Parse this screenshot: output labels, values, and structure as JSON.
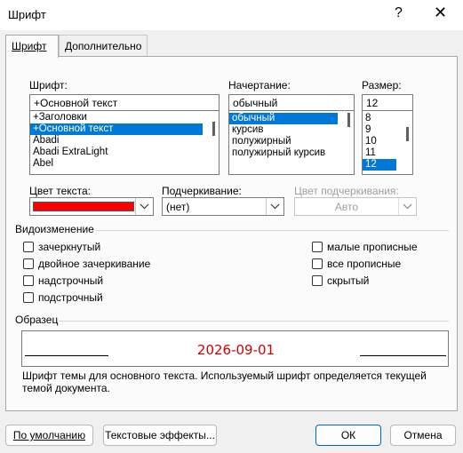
{
  "window": {
    "title": "Шрифт",
    "help_glyph": "?",
    "close_glyph": "✕"
  },
  "tabs": [
    {
      "label": "Шрифт"
    },
    {
      "label": "Дополнительно"
    }
  ],
  "font": {
    "label": "Шрифт:",
    "value": "+Основной текст",
    "options": [
      "+Заголовки",
      "+Основной текст",
      "Abadi",
      "Abadi ExtraLight",
      "Abel"
    ],
    "selected_index": 1
  },
  "style": {
    "label": "Начертание:",
    "value": "обычный",
    "options": [
      "обычный",
      "курсив",
      "полужирный",
      "полужирный курсив"
    ],
    "selected_index": 0
  },
  "size": {
    "label": "Размер:",
    "value": "12",
    "options": [
      "8",
      "9",
      "10",
      "11",
      "12"
    ],
    "selected_index": 4
  },
  "text_color": {
    "label": "Цвет текста:",
    "color": "#ff0000"
  },
  "underline": {
    "label": "Подчеркивание:",
    "value": "(нет)"
  },
  "underline_color": {
    "label": "Цвет подчеркивания:",
    "value": "Авто"
  },
  "effects": {
    "title": "Видоизменение",
    "left": [
      "зачеркнутый",
      "двойное зачеркивание",
      "надстрочный",
      "подстрочный"
    ],
    "right": [
      "малые прописные",
      "все прописные",
      "скрытый"
    ]
  },
  "preview": {
    "title": "Образец",
    "text": "2026-09-01",
    "text_color": "#d00000",
    "description": "Шрифт темы для основного текста. Используемый шрифт определяется текущей темой документа."
  },
  "buttons": {
    "default": "По умолчанию",
    "text_effects": "Текстовые эффекты...",
    "ok": "ОК",
    "cancel": "Отмена"
  }
}
